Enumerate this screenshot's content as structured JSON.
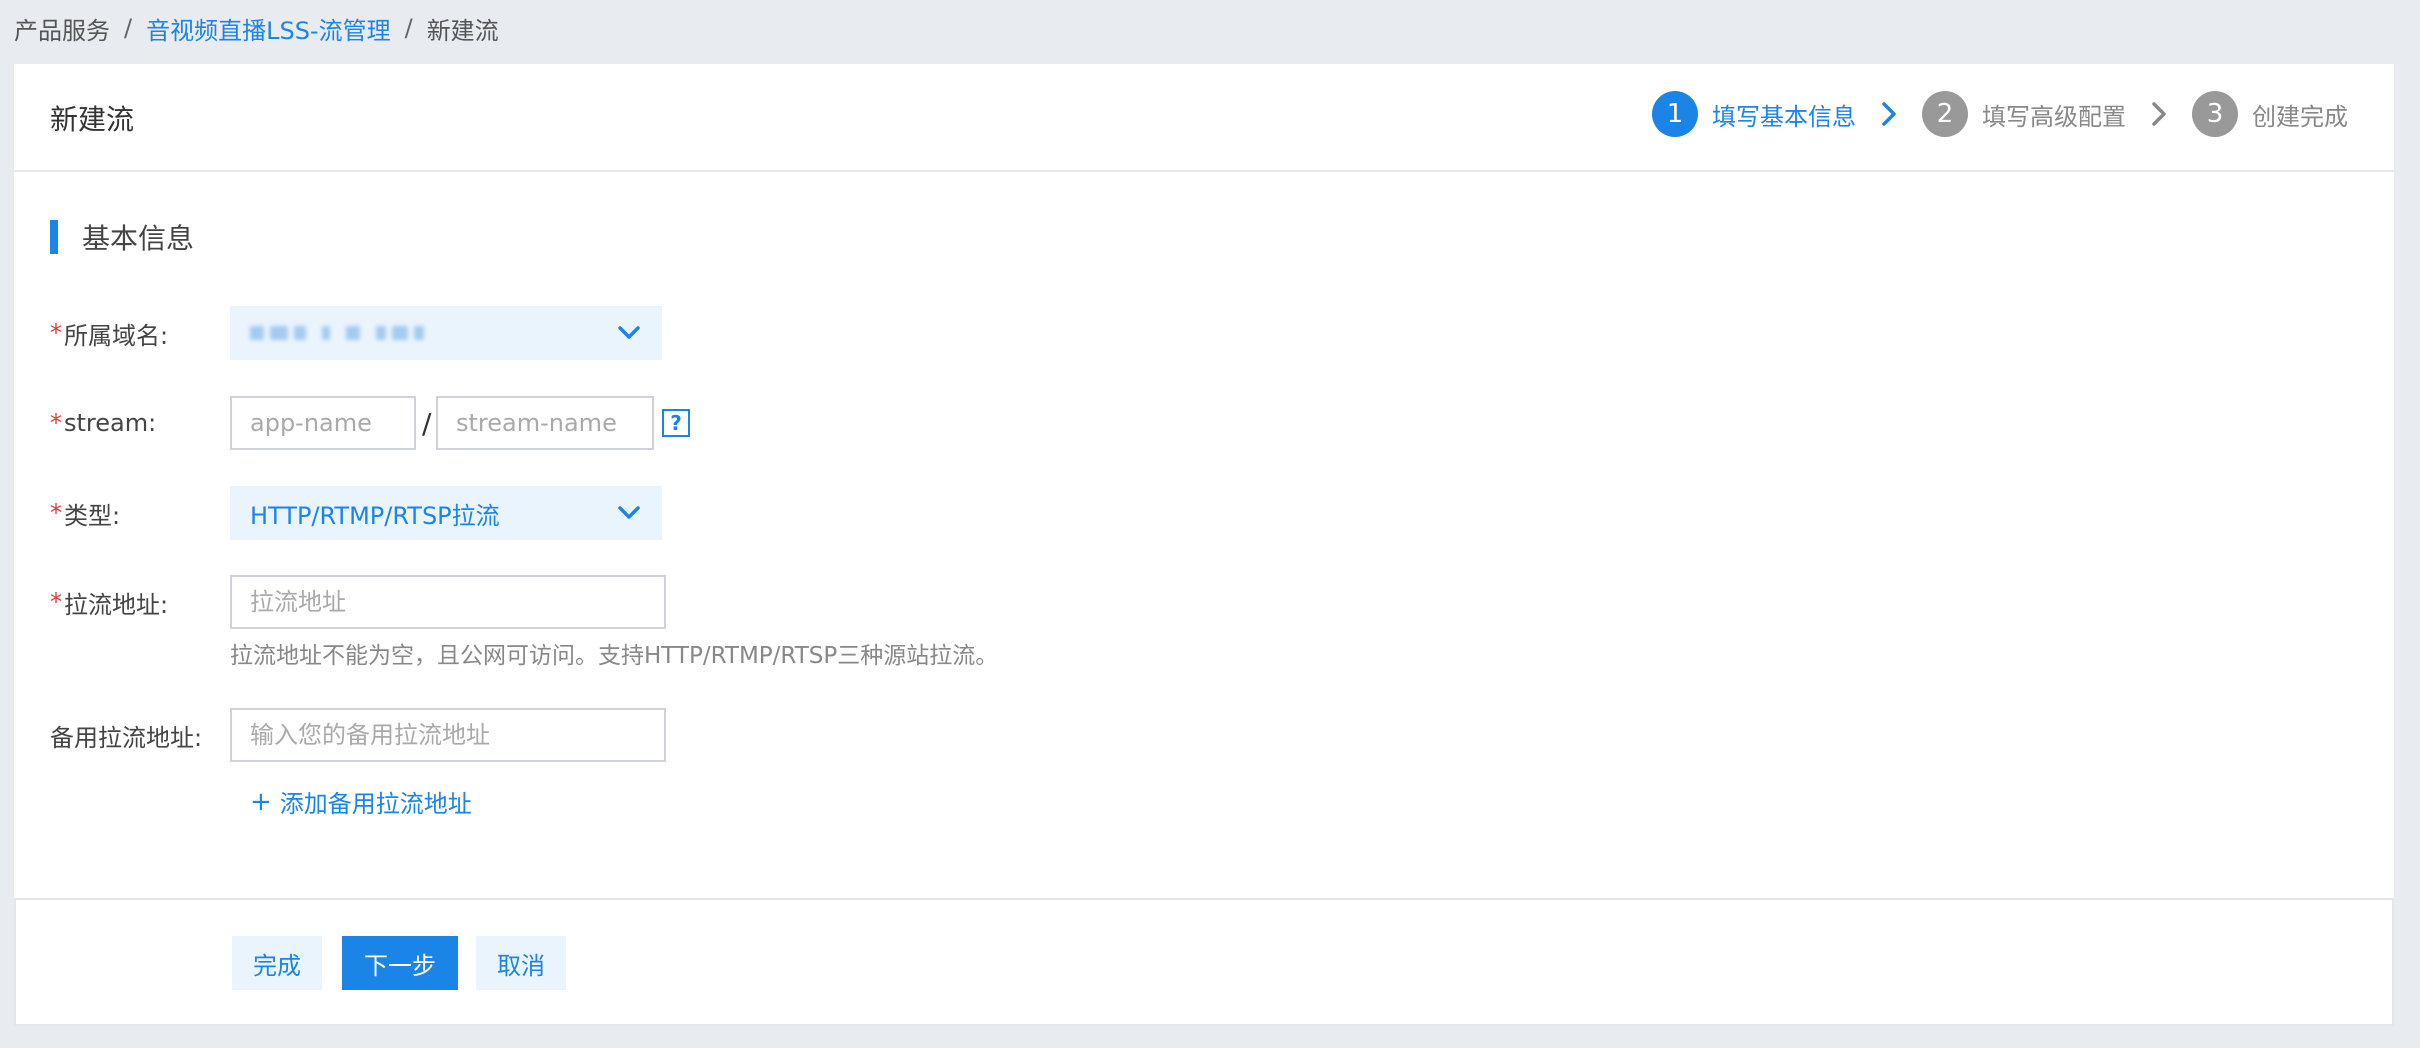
{
  "breadcrumb": {
    "items": [
      "产品服务",
      "音视频直播LSS-流管理",
      "新建流"
    ],
    "separator": "/"
  },
  "header": {
    "title": "新建流",
    "steps": [
      {
        "number": "1",
        "label": "填写基本信息",
        "state": "active"
      },
      {
        "number": "2",
        "label": "填写高级配置",
        "state": "inactive"
      },
      {
        "number": "3",
        "label": "创建完成",
        "state": "inactive"
      }
    ]
  },
  "section": {
    "title": "基本信息"
  },
  "form": {
    "required_mark": "*",
    "domain": {
      "label": "所属域名:",
      "value_obscured": true
    },
    "stream": {
      "label": "stream:",
      "app_placeholder": "app-name",
      "separator": "/",
      "stream_placeholder": "stream-name",
      "help_glyph": "?"
    },
    "type": {
      "label": "类型:",
      "value": "HTTP/RTMP/RTSP拉流"
    },
    "pull_url": {
      "label": "拉流地址:",
      "placeholder": "拉流地址",
      "hint": "拉流地址不能为空，且公网可访问。支持HTTP/RTMP/RTSP三种源站拉流。"
    },
    "backup_url": {
      "label": "备用拉流地址:",
      "placeholder": "输入您的备用拉流地址",
      "add_label": "添加备用拉流地址",
      "add_glyph": "+"
    }
  },
  "footer": {
    "finish": "完成",
    "next": "下一步",
    "cancel": "取消"
  },
  "colors": {
    "accent": "#1b84e7",
    "required": "#e03b3b",
    "page_bg": "#e8ebf0",
    "select_bg": "#eaf4fd"
  }
}
